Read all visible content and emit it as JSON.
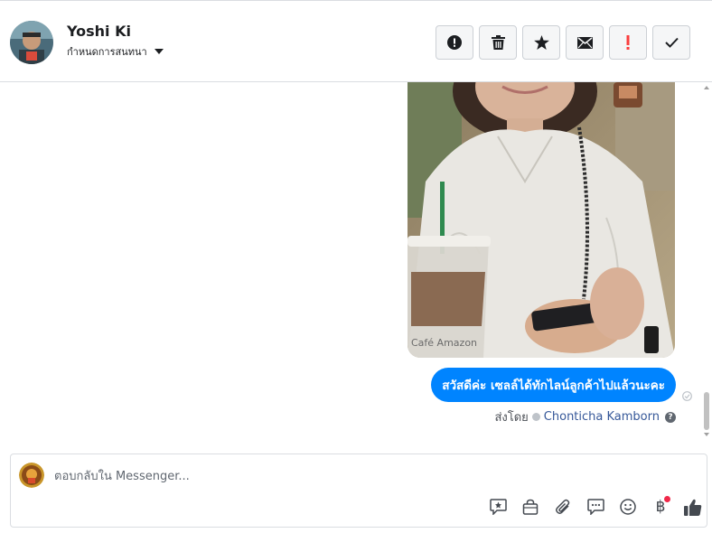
{
  "header": {
    "user_name": "Yoshi Ki",
    "conversation_setting_label": "กำหนดการสนทนา",
    "actions": [
      {
        "name": "mark-spam-button",
        "icon": "alert-circle-icon"
      },
      {
        "name": "delete-button",
        "icon": "trash-icon"
      },
      {
        "name": "star-button",
        "icon": "star-icon"
      },
      {
        "name": "mark-unread-button",
        "icon": "envelope-icon"
      },
      {
        "name": "follow-up-button",
        "icon": "exclamation-icon"
      },
      {
        "name": "mark-done-button",
        "icon": "check-icon"
      }
    ]
  },
  "thread": {
    "photo_caption": "Café Amazon",
    "message_text": "สวัสดีค่ะ เซลล์ได้ทักไลน์ลูกค้าไปแล้วนะคะ",
    "sent_by_label": "ส่งโดย",
    "sent_by_agent": "Chonticha Kamborn",
    "help_symbol": "?"
  },
  "composer": {
    "placeholder": "ตอบกลับใน Messenger...",
    "tools": [
      "saved-reply-icon",
      "shop-bag-icon",
      "paperclip-icon",
      "chat-bubble-icon",
      "smiley-icon",
      "baht-icon",
      "thumbs-up-icon"
    ],
    "baht_symbol": "฿"
  },
  "colors": {
    "accent": "#0084ff",
    "alert_red": "#fa3e3e",
    "link_blue": "#365899",
    "notification_dot": "#f02849"
  }
}
